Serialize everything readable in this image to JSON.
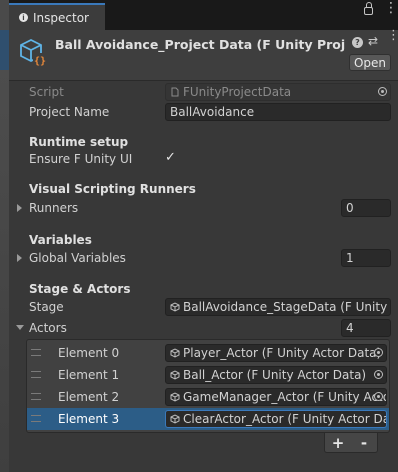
{
  "window": {
    "tab_label": "Inspector",
    "tab_icon": "info-icon",
    "lock_icon": "lock-icon",
    "menu_icon": "kebab-menu-icon"
  },
  "header": {
    "title": "Ball Avoidance_Project Data (F Unity Project Data)",
    "asset_icon": "scriptable-object-icon",
    "help_icon": "help-icon",
    "presets_icon": "presets-icon",
    "more_icon": "more-menu-icon",
    "open_label": "Open"
  },
  "fields": {
    "script_label": "Script",
    "script_value": "FUnityProjectData",
    "project_name_label": "Project Name",
    "project_name_value": "BallAvoidance"
  },
  "runtime": {
    "heading": "Runtime setup",
    "ensure_label": "Ensure F Unity UI",
    "ensure_checked": true,
    "check_glyph": "✓"
  },
  "visual_scripting": {
    "heading": "Visual Scripting Runners",
    "runners_label": "Runners",
    "runners_count": "0"
  },
  "variables": {
    "heading": "Variables",
    "global_label": "Global Variables",
    "global_count": "1"
  },
  "stage_actors": {
    "heading": "Stage & Actors",
    "stage_label": "Stage",
    "stage_value": "BallAvoidance_StageData (F Unity Stage Data)",
    "actors_label": "Actors",
    "actors_count": "4",
    "elements": [
      {
        "label": "Element 0",
        "value": "Player_Actor (F Unity Actor Data)",
        "selected": false
      },
      {
        "label": "Element 1",
        "value": "Ball_Actor (F Unity Actor Data)",
        "selected": false
      },
      {
        "label": "Element 2",
        "value": "GameManager_Actor (F Unity Actor Data)",
        "selected": false
      },
      {
        "label": "Element 3",
        "value": "ClearActor_Actor (F Unity Actor Data)",
        "selected": true
      }
    ],
    "add_label": "+",
    "remove_label": "-"
  },
  "colors": {
    "background": "#383838",
    "selection": "#2c5d87",
    "accent": "#3a79bb"
  }
}
